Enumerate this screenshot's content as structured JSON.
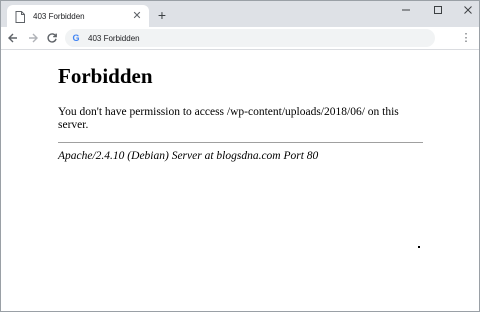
{
  "browser": {
    "tab": {
      "title": "403 Forbidden",
      "page_icon": "page-icon",
      "close_icon": "close-icon"
    },
    "new_tab_icon": "plus-icon",
    "window_controls": [
      "minimize-icon",
      "maximize-icon",
      "close-icon"
    ],
    "toolbar": {
      "back_icon": "arrow-left-icon",
      "forward_icon": "arrow-right-icon",
      "reload_icon": "reload-icon",
      "omnibox_icon": "google-g-icon",
      "address_text": "403 Forbidden",
      "menu_icon": "kebab-menu-icon"
    }
  },
  "page": {
    "heading": "Forbidden",
    "message": "You don't have permission to access /wp-content/uploads/2018/06/ on this server.",
    "server_signature": "Apache/2.4.10 (Debian) Server at blogsdna.com Port 80"
  }
}
